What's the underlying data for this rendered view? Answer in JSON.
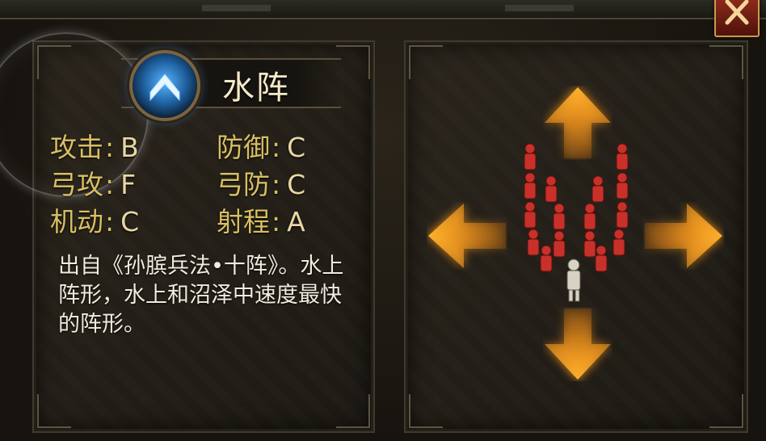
{
  "formation": {
    "title": "水阵",
    "icon": "chevron-up-icon",
    "stats": [
      {
        "label": "攻击",
        "value": "B"
      },
      {
        "label": "防御",
        "value": "C"
      },
      {
        "label": "弓攻",
        "value": "F"
      },
      {
        "label": "弓防",
        "value": "C"
      },
      {
        "label": "机动",
        "value": "C"
      },
      {
        "label": "射程",
        "value": "A"
      }
    ],
    "separator": ":",
    "description": "出自《孙膑兵法•十阵》。水上阵形，水上和沼泽中速度最快的阵形。"
  },
  "preview": {
    "arrows": [
      "up",
      "left",
      "right",
      "down"
    ],
    "arrow_color": "#f59a20",
    "troop_color": "#c8302a"
  },
  "close_button": {
    "icon": "close-icon"
  }
}
